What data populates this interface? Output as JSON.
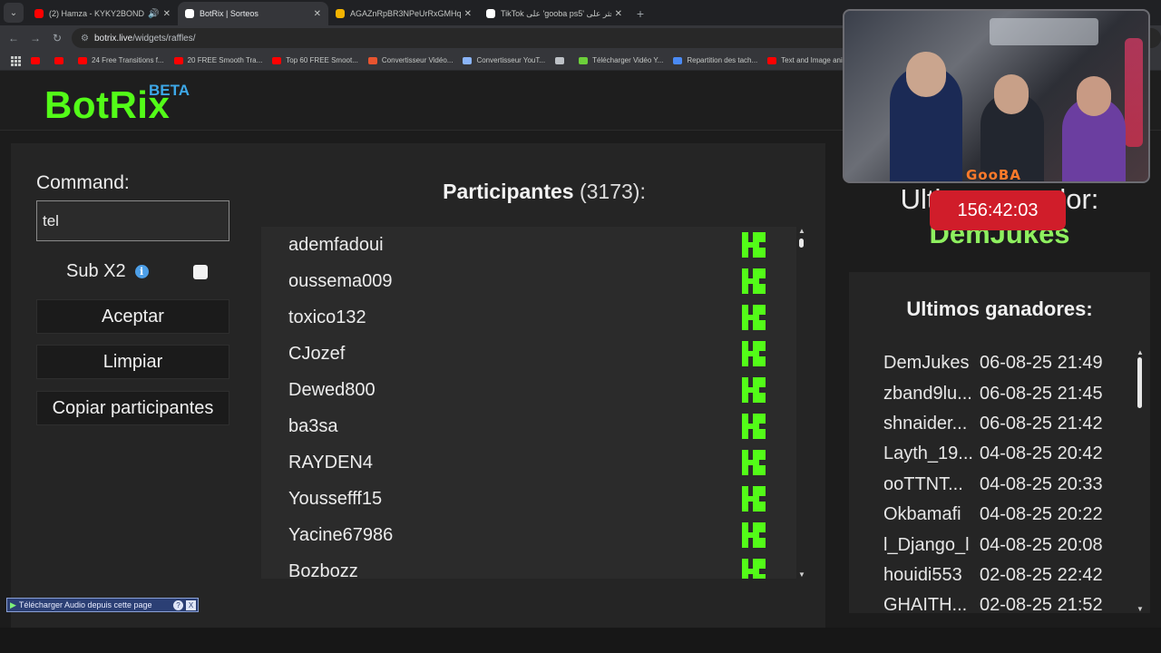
{
  "browser": {
    "tabs": [
      {
        "title": "(2) Hamza - KYKY2BONDY",
        "color": "#ff0000",
        "has_audio": true
      },
      {
        "title": "BotRix | Sorteos",
        "color": "#ffffff",
        "active": true
      },
      {
        "title": "AGAZnRpBR3NPeUrRxGMHqG",
        "color": "#f4b400"
      },
      {
        "title": "TikTok على 'gooba ps5' اعثر على",
        "color": "#ffffff"
      }
    ],
    "url_host": "botrix.live",
    "url_path": "/widgets/raffles/",
    "bookmarks": [
      {
        "label": "",
        "color": "#ff0000"
      },
      {
        "label": "",
        "color": "#ff0000"
      },
      {
        "label": "24 Free Transitions f...",
        "color": "#ff0000"
      },
      {
        "label": "20 FREE Smooth Tra...",
        "color": "#ff0000"
      },
      {
        "label": "Top 60 FREE Smoot...",
        "color": "#ff0000"
      },
      {
        "label": "Convertisseur Vidéo...",
        "color": "#e8542f"
      },
      {
        "label": "Convertisseur YouT...",
        "color": "#8ab4f8"
      },
      {
        "label": "",
        "color": "#bdc1c6"
      },
      {
        "label": "Télécharger Vidéo Y...",
        "color": "#6ccf3a"
      },
      {
        "label": "Repartition des tach...",
        "color": "#4a8af4"
      },
      {
        "label": "Text and Image ani...",
        "color": "#ff0000"
      }
    ]
  },
  "header": {
    "logo": "BotRix",
    "beta": "BETA"
  },
  "form": {
    "command_label": "Command:",
    "command_value": "tel",
    "sub_label": "Sub X2",
    "info_icon": "i",
    "buttons": {
      "accept": "Aceptar",
      "clear": "Limpiar",
      "copy": "Copiar participantes"
    }
  },
  "participants": {
    "title": "Participantes",
    "count": "(3173):",
    "list": [
      "ademfadoui",
      "oussema009",
      "toxico132",
      "CJozef",
      "Dewed800",
      "ba3sa",
      "RAYDEN4",
      "Youssefff15",
      "Yacine67986",
      "Bozbozz"
    ]
  },
  "last_winner": {
    "title": "Ultimo ganador:",
    "name": "DemJukes"
  },
  "winners": {
    "title": "Ultimos ganadores:",
    "list": [
      {
        "name": "DemJukes",
        "date": "06-08-25 21:49"
      },
      {
        "name": "zband9lu...",
        "date": "06-08-25 21:45"
      },
      {
        "name": "shnaider...",
        "date": "06-08-25 21:42"
      },
      {
        "name": "Layth_19...",
        "date": "04-08-25 20:42"
      },
      {
        "name": "ooTTNT...",
        "date": "04-08-25 20:33"
      },
      {
        "name": "Okbamafi",
        "date": "04-08-25 20:22"
      },
      {
        "name": "l_Django_l",
        "date": "04-08-25 20:08"
      },
      {
        "name": "houidi553",
        "date": "02-08-25 22:42"
      },
      {
        "name": "GHAITH...",
        "date": "02-08-25 21:52"
      }
    ]
  },
  "overlay": {
    "timer": "156:42:03",
    "stream_logo": "GooBA"
  },
  "download_bar": {
    "label": "Télécharger Audio depuis cette page",
    "help": "?",
    "close": "X"
  }
}
